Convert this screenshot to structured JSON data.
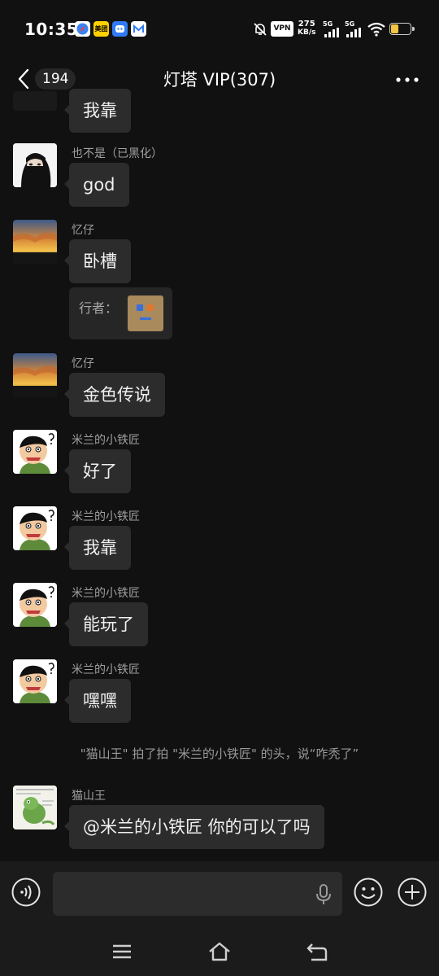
{
  "status_bar": {
    "time": "10:35",
    "app_icons": [
      {
        "name": "compass-app-icon",
        "color": "#e8433a"
      },
      {
        "name": "meituan-app-icon",
        "label": "美团",
        "color": "#ffd100"
      },
      {
        "name": "robot-app-icon",
        "color": "#2f7bf5"
      },
      {
        "name": "mail-app-icon",
        "color": "#ffffff"
      }
    ],
    "vpn": "VPN",
    "speed_value": "275",
    "speed_unit": "KB/s",
    "network_1": "5G",
    "network_2": "5G"
  },
  "header": {
    "unread_count": "194",
    "title": "灯塔 VIP(307)"
  },
  "messages": [
    {
      "sender": "",
      "text": "我靠",
      "avatar": "partial"
    },
    {
      "sender": "也不是（已黑化）",
      "text": "god",
      "avatar": "masked-person"
    },
    {
      "sender": "忆仔",
      "text": "卧槽",
      "avatar": "sunset"
    },
    {
      "quote_label": "行者："
    },
    {
      "sender": "忆仔",
      "text": "金色传说",
      "avatar": "sunset"
    },
    {
      "sender": "米兰的小铁匠",
      "text": "好了",
      "avatar": "cartoon-boy"
    },
    {
      "sender": "米兰的小铁匠",
      "text": "我靠",
      "avatar": "cartoon-boy"
    },
    {
      "sender": "米兰的小铁匠",
      "text": "能玩了",
      "avatar": "cartoon-boy"
    },
    {
      "sender": "米兰的小铁匠",
      "text": "嘿嘿",
      "avatar": "cartoon-boy"
    },
    {
      "sender": "猫山王",
      "text": "@米兰的小铁匠  你的可以了吗",
      "avatar": "green-dino-meme"
    }
  ],
  "system_message": "\"猫山王\" 拍了拍 \"米兰的小铁匠\" 的头，说“咋秃了”",
  "input_bar": {
    "voice_icon": "voice-icon",
    "mic_icon": "microphone-icon",
    "emoji_icon": "emoji-icon",
    "plus_icon": "plus-icon"
  },
  "nav_bar": {
    "menu_icon": "menu-icon",
    "home_icon": "home-icon",
    "back_icon": "back-icon"
  }
}
